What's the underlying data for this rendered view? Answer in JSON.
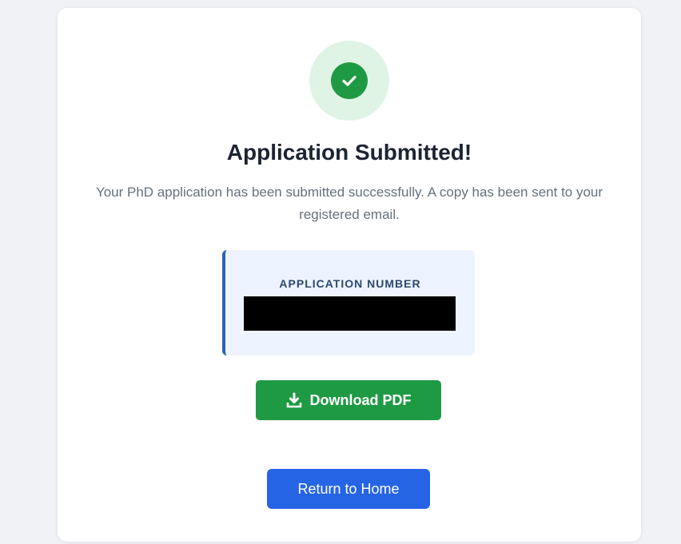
{
  "success": {
    "title": "Application Submitted!",
    "message": "Your PhD application has been submitted successfully. A copy has been sent to your registered email.",
    "icon": "check-circle-icon"
  },
  "application": {
    "label": "APPLICATION NUMBER"
  },
  "actions": {
    "download_label": "Download PDF",
    "download_icon": "download-icon",
    "home_label": "Return to Home"
  },
  "colors": {
    "success_green": "#1f9a44",
    "primary_blue": "#2664e6",
    "accent_border": "#2c5fb8",
    "page_background": "#f1f2f5"
  }
}
